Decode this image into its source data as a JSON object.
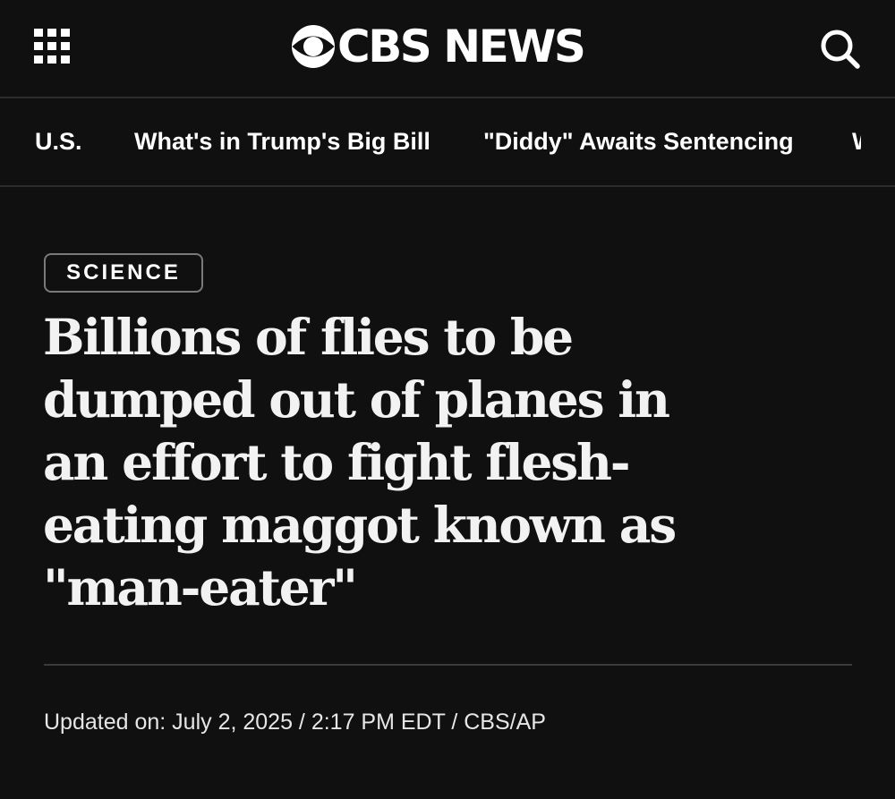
{
  "header": {
    "menu_icon": "grid-menu-icon",
    "logo_text": "CBS NEWS",
    "logo_icon": "cbs-eye-icon",
    "search_icon": "search-icon"
  },
  "topic_nav": {
    "items": [
      {
        "label": "U.S."
      },
      {
        "label": "What's in Trump's Big Bill"
      },
      {
        "label": "\"Diddy\" Awaits Sentencing"
      },
      {
        "label": "W"
      }
    ]
  },
  "article": {
    "category": "SCIENCE",
    "headline": "Billions of flies to be dumped out of planes in an effort to fight flesh-eating maggot known as \"man-eater\"",
    "byline": "Updated on: July 2, 2025 / 2:17 PM EDT / CBS/AP"
  },
  "colors": {
    "background": "#101010",
    "text": "#ffffff",
    "divider": "#2c2c2c",
    "badge_border": "#7a7a7a"
  }
}
